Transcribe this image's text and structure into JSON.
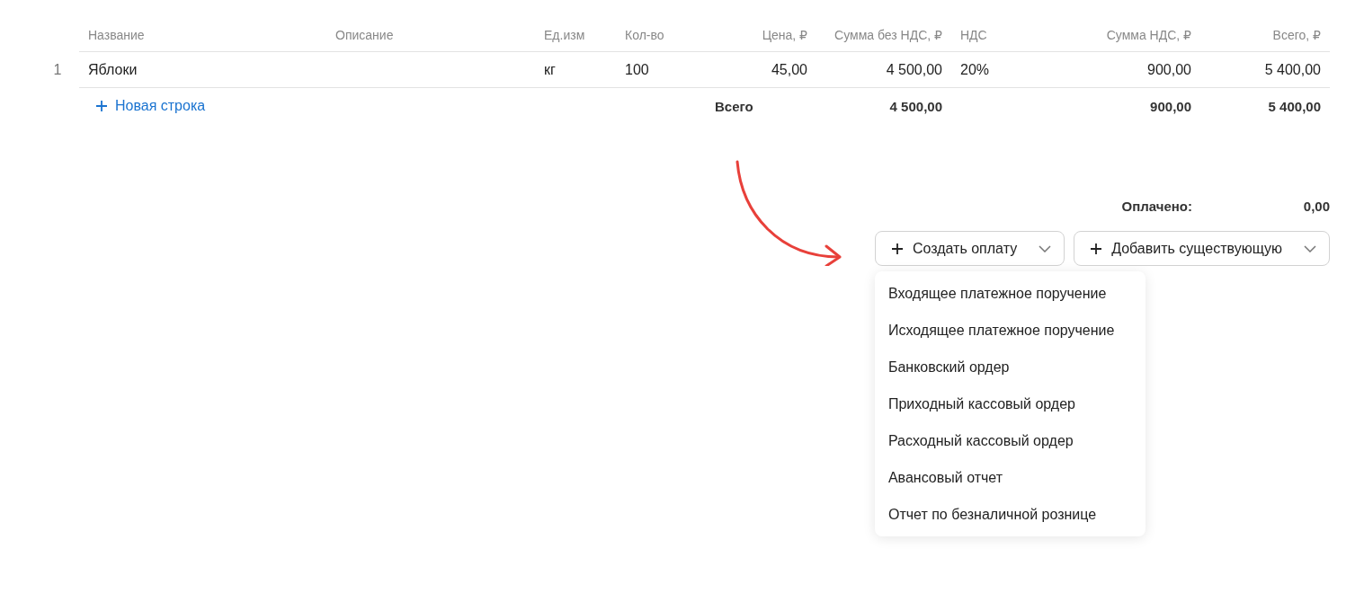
{
  "table": {
    "columns": [
      "Название",
      "Описание",
      "Ед.изм",
      "Кол-во",
      "Цена, ₽",
      "Сумма без НДС, ₽",
      "НДС",
      "Сумма НДС, ₽",
      "Всего, ₽"
    ],
    "rows": [
      {
        "number": "1",
        "name": "Яблоки",
        "unit": "кг",
        "qty": "100",
        "price": "45,00",
        "sum_net": "4 500,00",
        "vat_rate": "20%",
        "vat_sum": "900,00",
        "total": "5 400,00"
      }
    ],
    "add_row": "Новая строка",
    "totals": {
      "label": "Всего",
      "sum_net": "4 500,00",
      "vat_sum": "900,00",
      "total": "5 400,00"
    }
  },
  "paid": {
    "label": "Оплачено:",
    "value": "0,00"
  },
  "buttons": [
    {
      "label": "Создать оплату",
      "menu": [
        "Входящее платежное поручение",
        "Исходящее платежное поручение",
        "Банковский ордер",
        "Приходный кассовый ордер",
        "Расходный кассовый ордер",
        "Авансовый отчет",
        "Отчет по безналичной рознице"
      ]
    },
    {
      "label": "Добавить существующую"
    }
  ]
}
